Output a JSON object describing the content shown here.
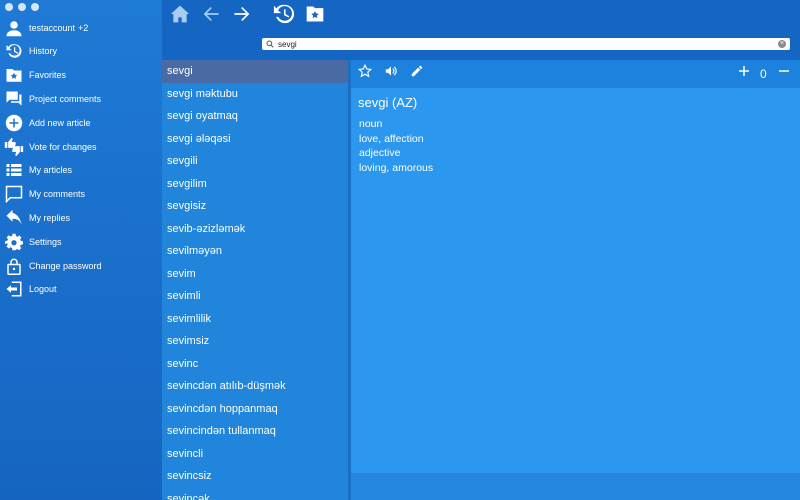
{
  "window": {
    "title": ""
  },
  "account": {
    "name": "testaccount",
    "badge": "+2"
  },
  "sidebar": {
    "items": [
      {
        "label": "History",
        "icon": "history-icon"
      },
      {
        "label": "Favorites",
        "icon": "favorites-folder-icon"
      },
      {
        "label": "Project comments",
        "icon": "comments-icon"
      },
      {
        "label": "Add new article",
        "icon": "add-icon"
      },
      {
        "label": "Vote for changes",
        "icon": "thumbs-icon"
      },
      {
        "label": "My articles",
        "icon": "list-icon"
      },
      {
        "label": "My comments",
        "icon": "comment-icon"
      },
      {
        "label": "My replies",
        "icon": "reply-icon"
      },
      {
        "label": "Settings",
        "icon": "gear-icon"
      },
      {
        "label": "Change password",
        "icon": "lock-icon"
      },
      {
        "label": "Logout",
        "icon": "logout-icon"
      }
    ]
  },
  "search": {
    "value": "sevgi",
    "placeholder": ""
  },
  "wordlist": {
    "selected": "sevgi",
    "items": [
      "sevgi",
      "sevgi məktubu",
      "sevgi oyatmaq",
      "sevgi ələqəsi",
      "sevgili",
      "sevgilim",
      "sevgisiz",
      "sevib-əzizləmək",
      "sevilməyən",
      "sevim",
      "sevimli",
      "sevimlilik",
      "sevimsiz",
      "sevinc",
      "sevincdən atılıb-düşmək",
      "sevincdən hoppanmaq",
      "sevincindən tullanmaq",
      "sevincli",
      "sevincsiz",
      "sevincək"
    ]
  },
  "article": {
    "title": "sevgi (AZ)",
    "lines": [
      "noun",
      "love, affection",
      "adjective",
      "loving, amorous"
    ],
    "rating": "0"
  },
  "colors": {
    "sidebar": "#1a70cf",
    "list": "#2085db",
    "article": "#2b97ee",
    "selected": "#4a6aa5"
  }
}
